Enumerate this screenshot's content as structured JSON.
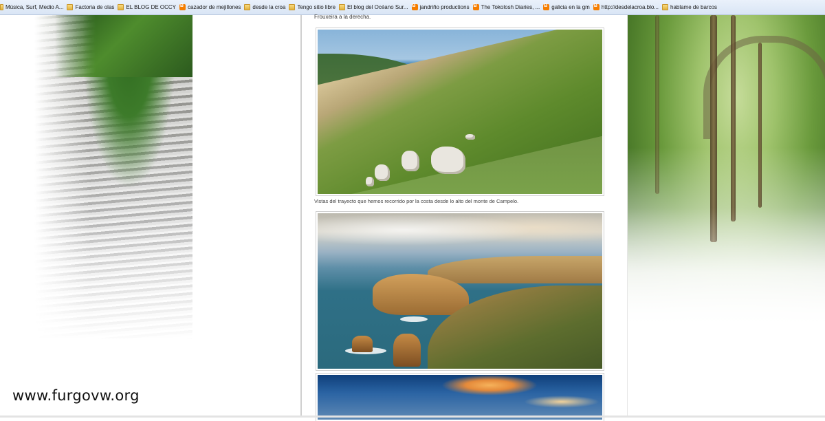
{
  "bookmarks_bar": {
    "items": [
      {
        "label": "Música, Surf, Medio A...",
        "icon": "folder-icon"
      },
      {
        "label": "Factoria de olas",
        "icon": "folder-icon"
      },
      {
        "label": "EL BLOG DE OCCY",
        "icon": "folder-icon"
      },
      {
        "label": "cazador de mejillones",
        "icon": "blogger-icon"
      },
      {
        "label": "desde la croa",
        "icon": "folder-icon"
      },
      {
        "label": "Tengo sitio libre",
        "icon": "folder-icon"
      },
      {
        "label": "El blog del Océano Sur...",
        "icon": "folder-icon"
      },
      {
        "label": "jandriño productions",
        "icon": "blogger-icon"
      },
      {
        "label": "The Tokolosh Diaries, ...",
        "icon": "blogger-icon"
      },
      {
        "label": "galicia en la gm",
        "icon": "blogger-icon"
      },
      {
        "label": "http://desdelacroa.blo...",
        "icon": "blogger-icon"
      },
      {
        "label": "hablame de barcos",
        "icon": "folder-icon"
      }
    ]
  },
  "post": {
    "intro_text": "Frouxeira a la derecha.",
    "caption_1": "Vistas del trayecto que hemos recorrido por la costa desde lo alto del monte de Campelo."
  },
  "watermark": "www.furgovw.org"
}
